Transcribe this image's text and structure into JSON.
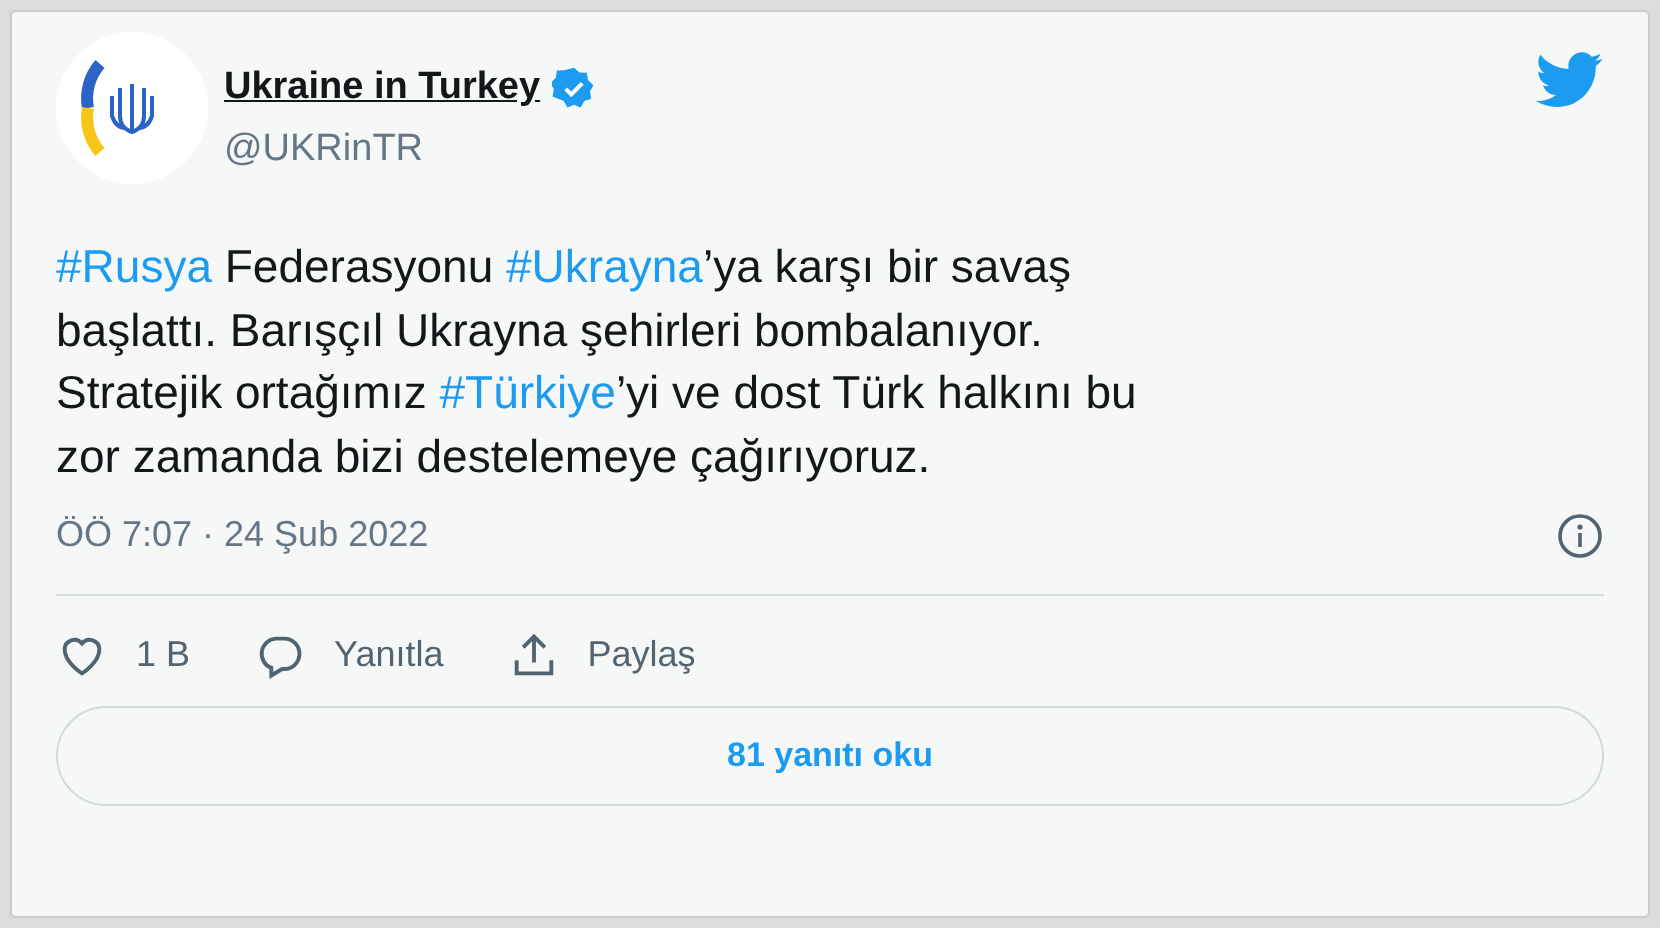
{
  "author": {
    "name": "Ukraine in Turkey",
    "handle": "@UKRinTR",
    "verified": true
  },
  "tweet": {
    "lines": [
      [
        {
          "kind": "hashtag",
          "text": "#Rusya"
        },
        {
          "kind": "plain",
          "text": " Federasyonu "
        },
        {
          "kind": "hashtag",
          "text": "#Ukrayna"
        },
        {
          "kind": "plain",
          "text": "’ya karşı bir savaş"
        }
      ],
      [
        {
          "kind": "plain",
          "text": "başlattı. Barışçıl Ukrayna şehirleri bombalanıyor."
        }
      ],
      [
        {
          "kind": "plain",
          "text": "Stratejik ortağımız "
        },
        {
          "kind": "hashtag",
          "text": "#Türkiye"
        },
        {
          "kind": "plain",
          "text": "’yi ve dost Türk halkını bu"
        }
      ],
      [
        {
          "kind": "plain",
          "text": "zor zamanda bizi destelemeye çağırıyoruz."
        }
      ]
    ]
  },
  "timestamp": "ÖÖ 7:07 · 24 Şub 2022",
  "actions": [
    {
      "kind": "like",
      "label": "1 B"
    },
    {
      "kind": "reply",
      "label": "Yanıtla"
    },
    {
      "kind": "share",
      "label": "Paylaş"
    }
  ],
  "read_replies_button": "81 yanıtı oku"
}
